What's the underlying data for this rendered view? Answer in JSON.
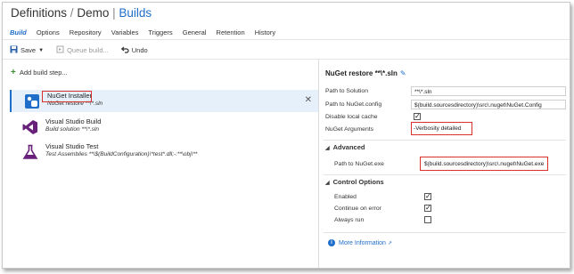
{
  "header": {
    "breadcrumb_root": "Definitions",
    "breadcrumb_sep": "/",
    "breadcrumb_project": "Demo",
    "breadcrumb_bar": "|",
    "breadcrumb_current": "Builds"
  },
  "tabs": [
    "Build",
    "Options",
    "Repository",
    "Variables",
    "Triggers",
    "General",
    "Retention",
    "History"
  ],
  "toolbar": {
    "save_label": "Save",
    "queue_label": "Queue build...",
    "undo_label": "Undo"
  },
  "add_step_label": "Add build step...",
  "steps": [
    {
      "name": "NuGet Installer",
      "sub": "NuGet restore **\\*.sln",
      "icon": "nuget-icon"
    },
    {
      "name": "Visual Studio Build",
      "sub": "Build solution **\\*.sln",
      "icon": "visual-studio-icon"
    },
    {
      "name": "Visual Studio Test",
      "sub": "Test Assemblies **\\$(BuildConfiguration)\\*test*.dll;-:**\\obj\\**",
      "icon": "flask-icon"
    }
  ],
  "details": {
    "title": "NuGet restore **\\*.sln",
    "path_to_solution_label": "Path to Solution",
    "path_to_solution_value": "**\\*.sln",
    "path_to_nuget_config_label": "Path to NuGet.config",
    "path_to_nuget_config_value": "$(build.sourcesdirectory)\\src\\.nuget\\NuGet.Config",
    "disable_local_cache_label": "Disable local cache",
    "disable_local_cache_checked": true,
    "nuget_arguments_label": "NuGet Arguments",
    "nuget_arguments_value": "-Verbosity detailed",
    "advanced_label": "Advanced",
    "path_to_nuget_exe_label": "Path to NuGet.exe",
    "path_to_nuget_exe_value": "$(build.sourcesdirectory)\\src\\.nuget\\NuGet.exe",
    "control_options_label": "Control Options",
    "enabled_label": "Enabled",
    "enabled_checked": true,
    "continue_on_error_label": "Continue on error",
    "continue_on_error_checked": true,
    "always_run_label": "Always run",
    "always_run_checked": false,
    "more_information_label": "More Information"
  },
  "colors": {
    "accent": "#1f6ec9",
    "highlight_box": "#d9312b",
    "add_icon": "#3c8e32"
  }
}
